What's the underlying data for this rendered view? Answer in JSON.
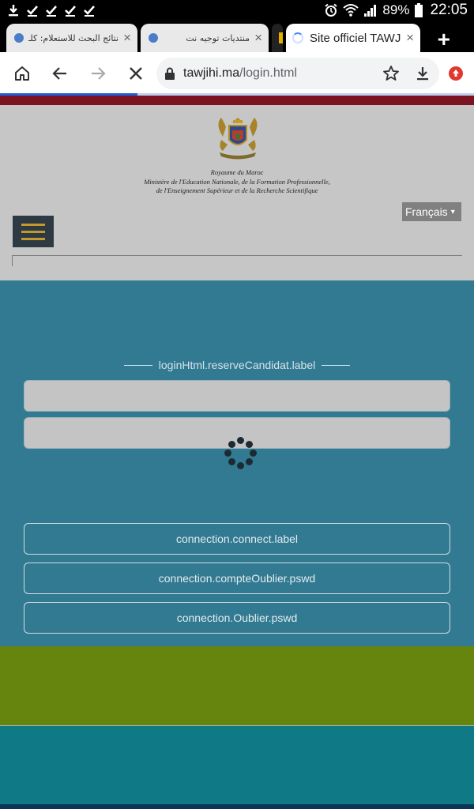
{
  "status_bar": {
    "battery": "89%",
    "time": "22:05",
    "left_icons": [
      "download-icon",
      "check-icon",
      "check-icon",
      "check-icon",
      "check-icon"
    ],
    "right_icons": [
      "alarm-icon",
      "wifi-icon",
      "signal-icon",
      "battery-icon"
    ]
  },
  "tabs": [
    {
      "title": "نتائج البحث للاستعلام: كلـ",
      "close": "×"
    },
    {
      "title": "منتديات توجيه نت",
      "close": "×"
    },
    {
      "title": "Site officiel TAWJIHI",
      "close": "×"
    }
  ],
  "new_tab": "+",
  "address_bar": {
    "domain": "tawjihi.ma",
    "path": "/login.html",
    "load_progress": 0.29
  },
  "header": {
    "org_line1": "Royaume du Maroc",
    "org_line2": "Ministère de l'Education Nationale, de la Formation Professionnelle,",
    "org_line3": "de l'Enseignement Supérieur et de la Recherche Scientifique",
    "language": "Français",
    "language_caret": "▾"
  },
  "login": {
    "section_label": "loginHtml.reserveCandidat.label",
    "connect_label": "connection.connect.label",
    "forgot_account_label": "connection.compteOublier.pswd",
    "forgot_password_label": "connection.Oublier.pswd"
  },
  "colors": {
    "header_bg": "#c6c6c6",
    "top_red_bar": "#7c1320",
    "login_bg": "#327a91",
    "green_band": "#66850f",
    "teal_band": "#0f7a86",
    "menu_button": "#2d3a44",
    "menu_bars": "#c49a2a"
  }
}
